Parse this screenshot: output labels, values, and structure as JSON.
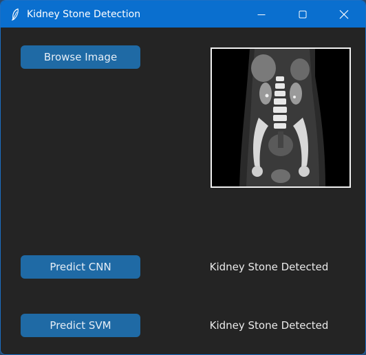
{
  "window": {
    "title": "Kidney Stone Detection",
    "icons": {
      "app": "feather-icon",
      "minimize": "minimize-icon",
      "maximize": "maximize-icon",
      "close": "close-icon"
    }
  },
  "buttons": {
    "browse": "Browse Image",
    "predict_cnn": "Predict CNN",
    "predict_svm": "Predict SVM"
  },
  "results": {
    "cnn": "Kidney Stone Detected",
    "svm": "Kidney Stone Detected"
  },
  "colors": {
    "titlebar": "#0a6fcf",
    "background": "#242424",
    "button": "#1f6aa5",
    "text": "#eaeaea"
  }
}
